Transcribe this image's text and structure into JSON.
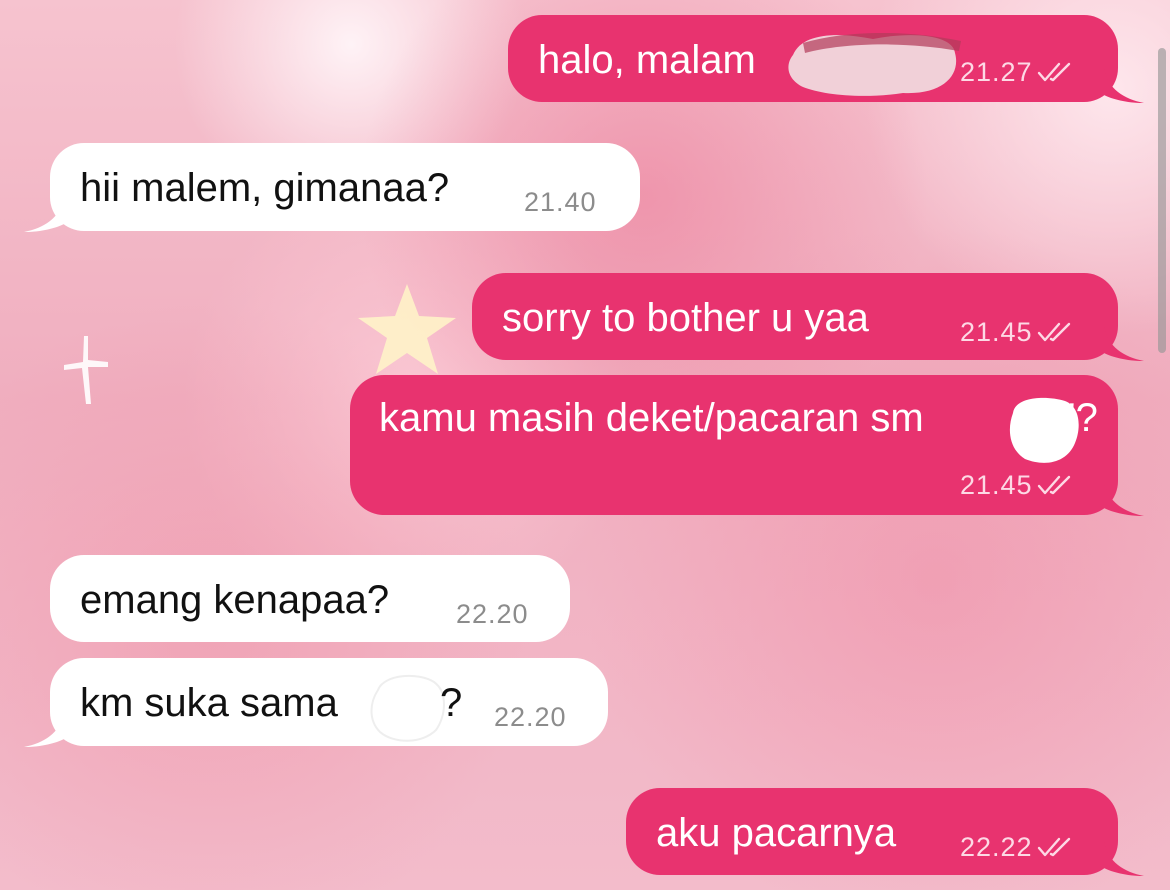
{
  "theme": {
    "outgoing_bubble": "#e8336f",
    "incoming_bubble": "#ffffff",
    "outgoing_text": "#ffffff",
    "incoming_text": "#111111",
    "wallpaper": "#f3b9c8"
  },
  "messages": [
    {
      "direction": "outgoing",
      "text": "halo, malam",
      "time": "21.27",
      "status_icon": "double-check-icon",
      "redacted": true
    },
    {
      "direction": "incoming",
      "text": "hii malem, gimanaa?",
      "time": "21.40"
    },
    {
      "direction": "outgoing",
      "text": "sorry to bother u yaa",
      "time": "21.45",
      "status_icon": "double-check-icon"
    },
    {
      "direction": "outgoing",
      "text": "kamu masih deket/pacaran sm",
      "text_suffix": "'?",
      "time": "21.45",
      "status_icon": "double-check-icon",
      "redacted": true
    },
    {
      "direction": "incoming",
      "text": "emang kenapaa?",
      "time": "22.20"
    },
    {
      "direction": "incoming",
      "text": "km suka sama",
      "text_suffix": "?",
      "time": "22.20",
      "redacted": true
    },
    {
      "direction": "outgoing",
      "text": "aku pacarnya",
      "time": "22.22",
      "status_icon": "double-check-icon"
    }
  ]
}
